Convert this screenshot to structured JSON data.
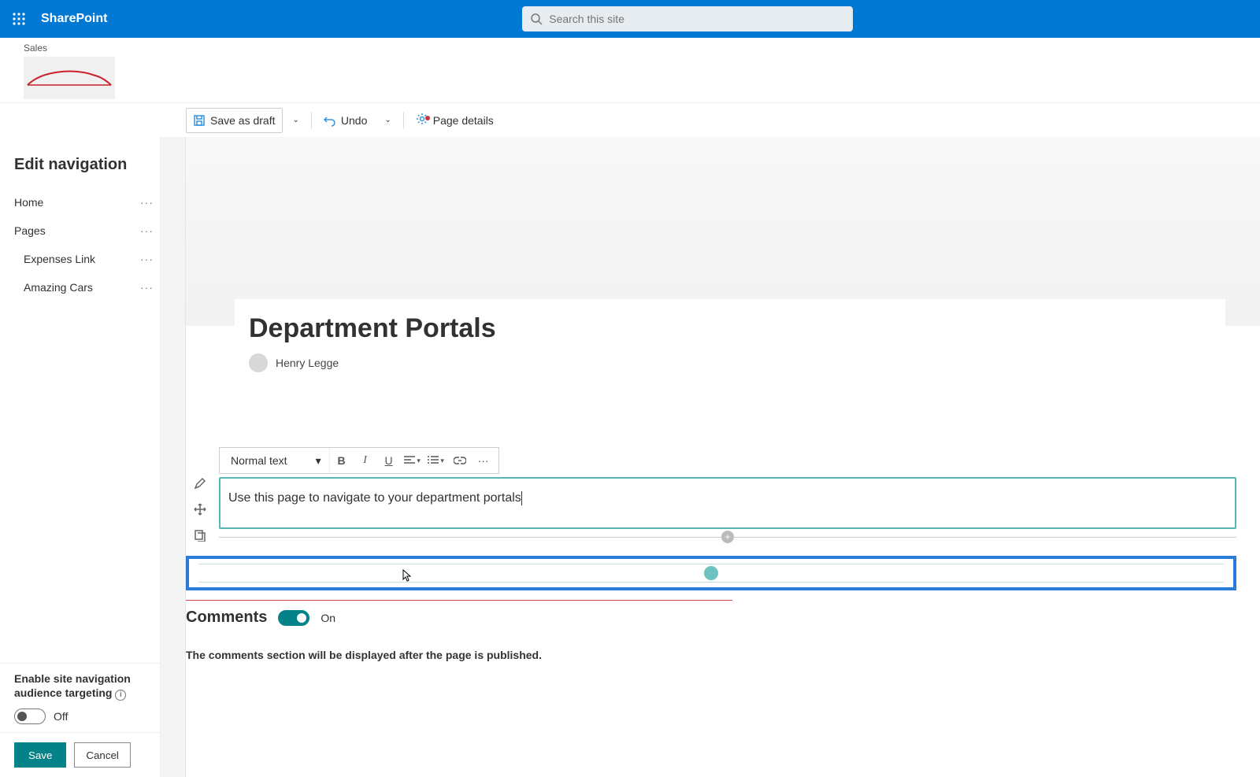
{
  "suite": {
    "app_name": "SharePoint"
  },
  "search": {
    "placeholder": "Search this site"
  },
  "site": {
    "label": "Sales"
  },
  "cmd": {
    "save_draft": "Save as draft",
    "undo": "Undo",
    "page_details": "Page details"
  },
  "nav": {
    "title": "Edit navigation",
    "items": [
      "Home",
      "Pages",
      "Expenses Link",
      "Amazing Cars"
    ]
  },
  "nav_footer": {
    "targeting_line1": "Enable site navigation",
    "targeting_line2": "audience targeting",
    "targeting_state": "Off",
    "save": "Save",
    "cancel": "Cancel"
  },
  "page": {
    "title": "Department Portals",
    "author": "Henry Legge",
    "body_text": "Use this page to navigate to your department portals"
  },
  "rte": {
    "style": "Normal text"
  },
  "comments": {
    "heading": "Comments",
    "state": "On",
    "note": "The comments section will be displayed after the page is published."
  }
}
